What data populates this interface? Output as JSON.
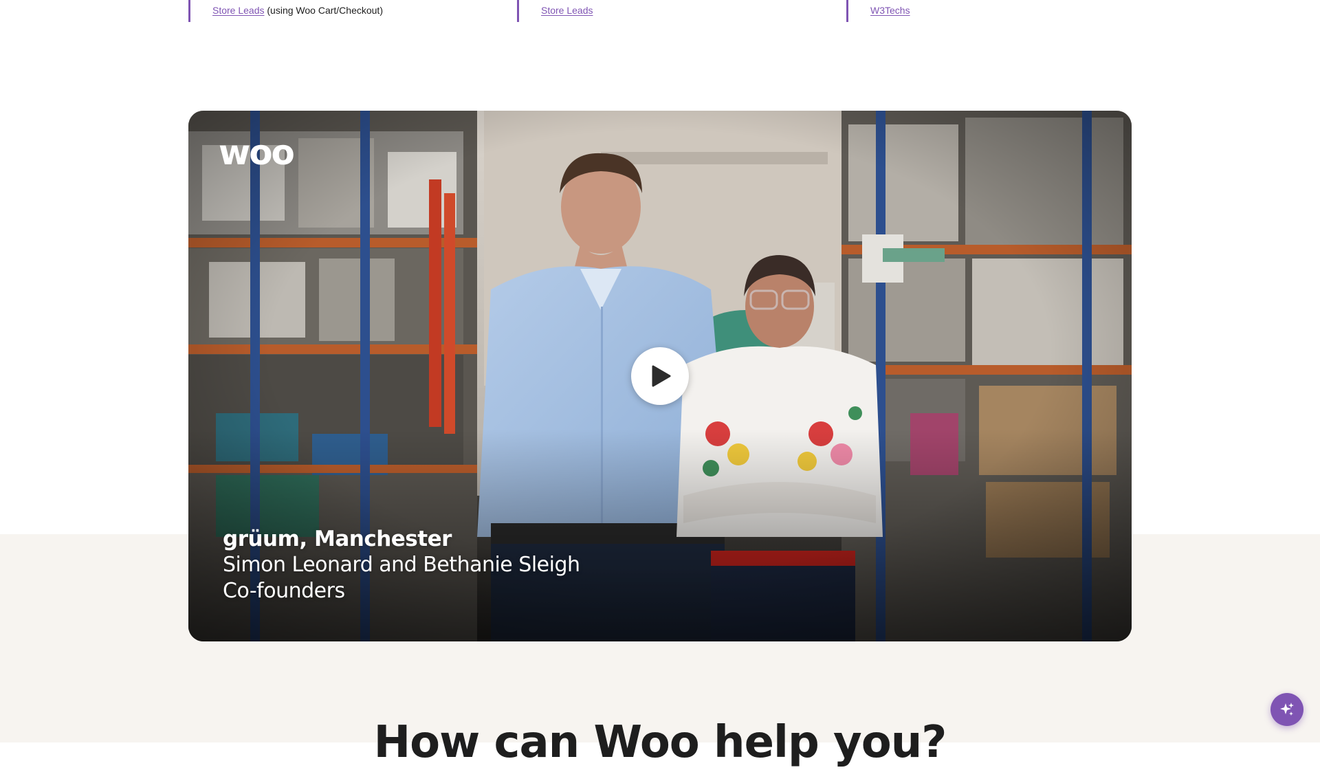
{
  "sources": [
    {
      "link": "Store Leads",
      "note": "(using Woo Cart/Checkout)"
    },
    {
      "link": "Store Leads",
      "note": ""
    },
    {
      "link": "W3Techs",
      "note": ""
    }
  ],
  "video": {
    "logo_text": "woo",
    "caption": {
      "brand": "grüum, Manchester",
      "names": "Simon Leonard and Bethanie Sleigh",
      "role": "Co-founders"
    },
    "play_icon": "play-icon"
  },
  "section": {
    "heading": "How can Woo help you?"
  },
  "fab": {
    "icon": "sparkle-icon"
  },
  "colors": {
    "accent": "#7f54b3",
    "beige": "#f7f4f0",
    "text": "#1e1e1e"
  }
}
